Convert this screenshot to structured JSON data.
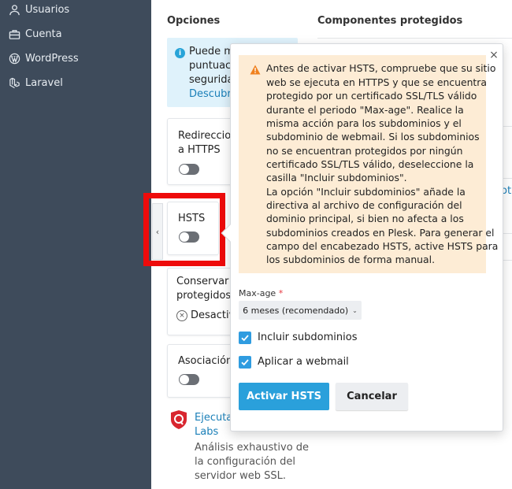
{
  "sidebar": {
    "items": [
      {
        "label": "Usuarios",
        "icon": "user-icon"
      },
      {
        "label": "Cuenta",
        "icon": "briefcase-icon"
      },
      {
        "label": "WordPress",
        "icon": "wordpress-icon"
      },
      {
        "label": "Laravel",
        "icon": "laravel-icon"
      }
    ]
  },
  "main": {
    "options_title": "Opciones",
    "protected_title": "Componentes protegidos",
    "info": {
      "lines": [
        "Puede m",
        "puntuacio",
        "segurida"
      ],
      "link": "Descubra"
    },
    "cards": {
      "redirect": {
        "lines": [
          "Redireccion",
          "a HTTPS"
        ]
      },
      "hsts": {
        "label": "HSTS"
      },
      "conserve": {
        "lines": [
          "Conservar lo",
          "protegidos"
        ],
        "status": "Desactiva"
      },
      "association": {
        "label": "Asociación c"
      }
    },
    "right_link_fragment": "ot",
    "ssllabs": {
      "link_lines": [
        "Ejecutar",
        "Labs"
      ],
      "desc_lines": [
        "Análisis exhaustivo de",
        "la configuración del",
        "servidor web SSL."
      ]
    }
  },
  "popover": {
    "warning_lines": [
      "Antes de activar HSTS, compruebe que su sitio",
      "web se ejecuta en HTTPS y que se encuentra",
      "protegido por un certificado SSL/TLS válido",
      "durante el periodo \"Max-age\". Realice la",
      "misma acción para los subdominios y el",
      "subdominio de webmail. Si los subdominios",
      "no se encuentran protegidos por ningún",
      "certificado SSL/TLS válido, deseleccione la",
      "casilla \"Incluir subdominios\".",
      "La opción \"Incluir subdominios\" añade la",
      "directiva al archivo de configuración del",
      "dominio principal, si bien no afecta a los",
      "subdominios creados en Plesk. Para generar el",
      "campo del encabezado HSTS, active HSTS para",
      "los subdominios de forma manual."
    ],
    "max_age_label": "Max-age",
    "required_mark": "*",
    "max_age_value": "6 meses (recomendado)",
    "include_subdomains": "Incluir subdominios",
    "apply_webmail": "Aplicar a webmail",
    "submit": "Activar HSTS",
    "cancel": "Cancelar",
    "close_symbol": "×"
  },
  "colors": {
    "sidebar_bg": "#3e4b5b",
    "primary": "#2aa0db",
    "warning_bg": "#fdecd5",
    "highlight": "#ee0b0b",
    "info_bg": "#dff2fb"
  }
}
